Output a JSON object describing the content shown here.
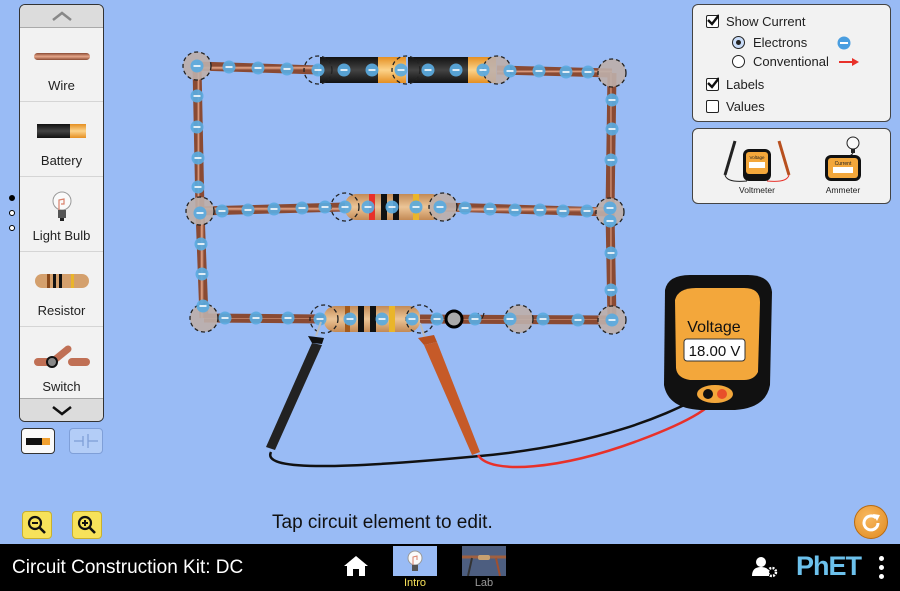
{
  "app": {
    "title": "Circuit Construction Kit: DC"
  },
  "carousel": {
    "items": [
      {
        "label": "Wire",
        "icon": "wire-icon"
      },
      {
        "label": "Battery",
        "icon": "battery-icon"
      },
      {
        "label": "Light Bulb",
        "icon": "light-bulb-icon"
      },
      {
        "label": "Resistor",
        "icon": "resistor-icon"
      },
      {
        "label": "Switch",
        "icon": "switch-icon"
      }
    ],
    "page_dots": 3,
    "active_page": 1
  },
  "view_toggle": {
    "selected": "lifelike",
    "options": [
      "lifelike",
      "schematic"
    ]
  },
  "control_panel": {
    "show_current": {
      "label": "Show Current",
      "checked": true
    },
    "electrons": {
      "label": "Electrons",
      "selected": true
    },
    "conventional": {
      "label": "Conventional",
      "selected": false
    },
    "labels": {
      "label": "Labels",
      "checked": true
    },
    "values": {
      "label": "Values",
      "checked": false
    }
  },
  "sensor_toolbox": {
    "voltmeter": {
      "label": "Voltmeter",
      "screen_title": "Voltage",
      "readout": "----"
    },
    "ammeter": {
      "label": "Ammeter",
      "screen_title": "Current",
      "readout": "----"
    }
  },
  "voltmeter": {
    "title": "Voltage",
    "reading": "18.00 V"
  },
  "hint": "Tap circuit element to edit.",
  "colors": {
    "background": "#99bbf5",
    "electron": "#5aaae0",
    "conventional_arrow": "#e8312a",
    "meter_body": "#f3a73b",
    "nav_selected": "#f7e25a"
  },
  "navbar": {
    "screens": [
      {
        "label": "Intro",
        "selected": true
      },
      {
        "label": "Lab",
        "selected": false
      }
    ],
    "brand": "PhET"
  }
}
